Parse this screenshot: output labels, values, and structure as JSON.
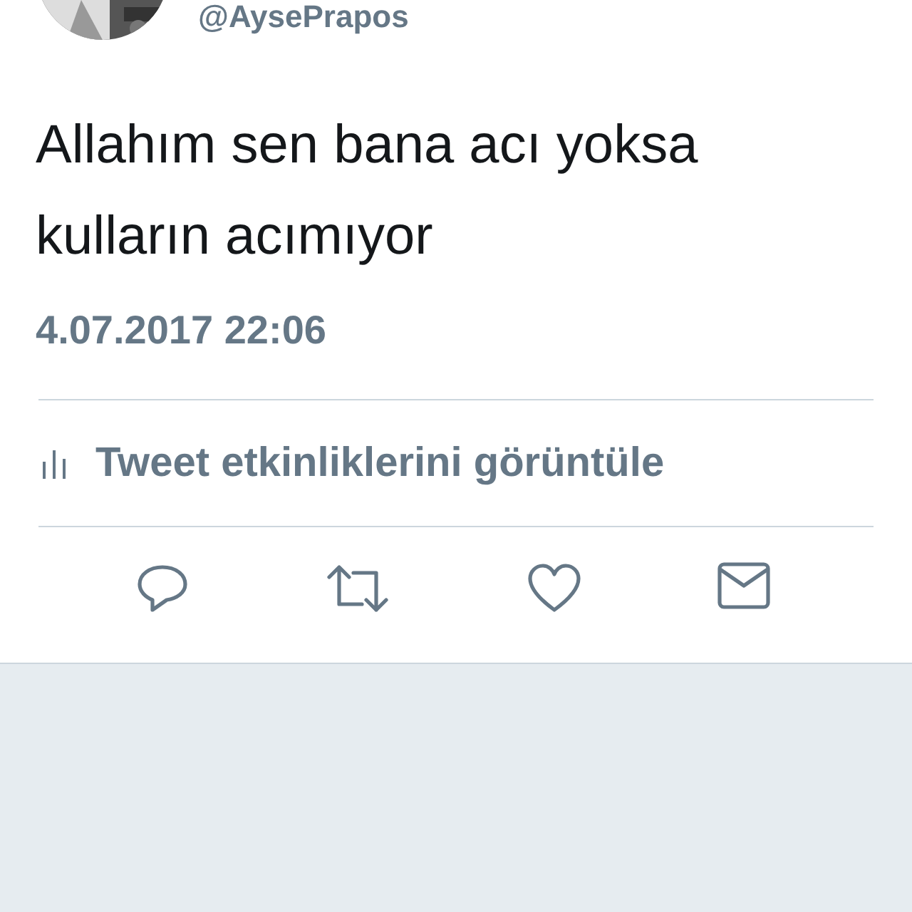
{
  "author": {
    "handle": "@AysePrapos"
  },
  "tweet": {
    "text": "Allahım sen bana acı yoksa kulların acımıyor",
    "timestamp": "4.07.2017 22:06"
  },
  "activity_link": "Tweet etkinliklerini görüntüle",
  "actions": [
    {
      "kind": "reply"
    },
    {
      "kind": "retweet"
    },
    {
      "kind": "like"
    },
    {
      "kind": "message"
    }
  ]
}
